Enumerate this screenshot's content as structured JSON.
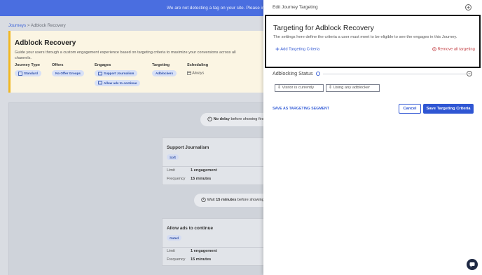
{
  "banner": {
    "text": "We are not detecting a tag on your site. Please install the"
  },
  "breadcrumb": {
    "root": "Journeys",
    "separator": ">",
    "current": "Adblock Recovery"
  },
  "hero": {
    "title": "Adblock Recovery",
    "description": "Guide your users through a custom engagement experience based on targeting criteria to maximize your conversions across all channels.",
    "journey_type_label": "Journey Type",
    "journey_type_value": "Standard",
    "offers_label": "Offers",
    "offers_value": "No Offer Groups",
    "engages_label": "Engages",
    "engages_values": [
      "Support Journalism",
      "Allow ads to continue"
    ],
    "targeting_label": "Targeting",
    "targeting_value": "Adblockers",
    "scheduling_label": "Scheduling",
    "scheduling_value": "Always"
  },
  "flow": {
    "delay1_bold": "No delay",
    "delay1_rest": "before showing first",
    "card1": {
      "title": "Support Journalism",
      "tag": "Soft",
      "limit_label": "Limit",
      "limit_value": "1 engagement",
      "freq_label": "Frequency",
      "freq_value": "15 minutes"
    },
    "delay2_prefix": "Wait",
    "delay2_bold": "15 minutes",
    "delay2_rest": "before showing n",
    "card2": {
      "title": "Allow ads to continue",
      "tag": "Gated",
      "limit_label": "Limit",
      "limit_value": "1 engagement",
      "freq_label": "Frequency",
      "freq_value": "15 minutes"
    }
  },
  "panel": {
    "title": "Edit Journey Targeting",
    "heading": "Targeting for Adblock Recovery",
    "subheading": "The settings here define the criteria a user must meet to be eligible to see the engages in this Journey.",
    "add_label": "Add Targeting Criteria",
    "remove_label": "Remove all targeting",
    "section_label": "Adblocking Status",
    "dropdown1": "Visitor is currently",
    "dropdown2": "Using any adblocker",
    "save_segment": "SAVE AS TARGETING SEGMENT",
    "cancel": "Cancel",
    "save": "Save Targeting Criteria"
  },
  "colors": {
    "brand_blue": "#2f56d3",
    "banner_blue": "#4a6ee0",
    "warn": "#f0b722",
    "danger": "#c0353a"
  }
}
